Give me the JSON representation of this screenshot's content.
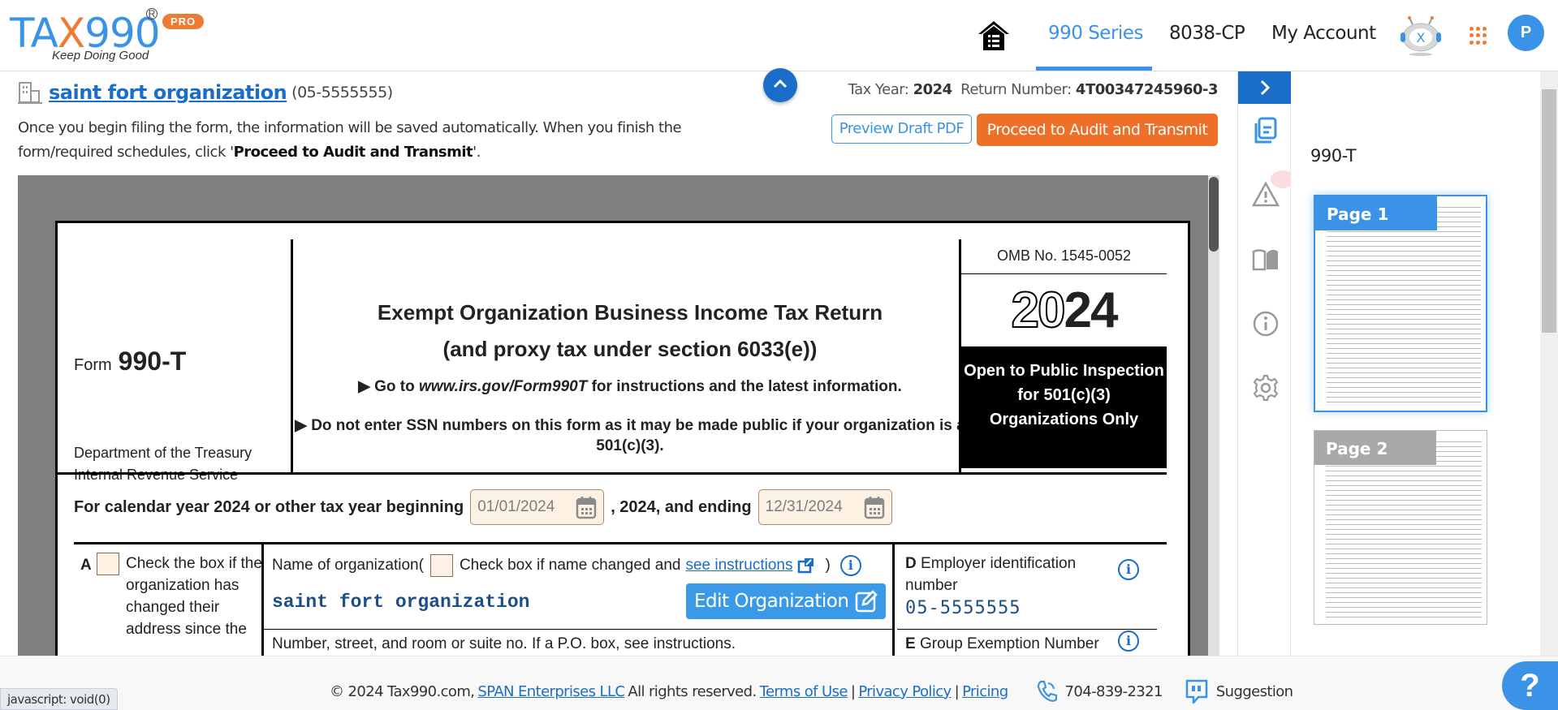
{
  "header": {
    "logo": {
      "brand_pre": "TA",
      "brand_x": "X",
      "brand_post": "990",
      "registered": "R",
      "badge": "PRO",
      "tagline": "Keep Doing Good"
    },
    "nav": [
      {
        "label": "990 Series",
        "active": true
      },
      {
        "label": "8038-CP",
        "active": false
      },
      {
        "label": "My Account",
        "active": false
      }
    ],
    "avatar_initial": "P",
    "bot_letter": "X"
  },
  "org": {
    "name": "saint fort organization",
    "ein_display": "(05-5555555)",
    "hint_pre": "Once you begin filing the form, the information will be saved automatically. When you finish the form/required schedules, click '",
    "hint_bold": "Proceed to Audit and Transmit",
    "hint_post": "'."
  },
  "return_info": {
    "tax_year_label": "Tax Year:",
    "tax_year": "2024",
    "return_number_label": "Return Number:",
    "return_number": "4T00347245960-3"
  },
  "actions": {
    "collapse": "^",
    "preview": "Preview Draft PDF",
    "proceed": "Proceed to Audit and Transmit"
  },
  "form": {
    "form_word": "Form",
    "form_number": "990-T",
    "dept1": "Department of the Treasury",
    "dept2": "Internal Revenue Service",
    "title1": "Exempt Organization Business Income Tax Return",
    "title2": "(and proxy tax under section 6033(e))",
    "go_pre": "▶ Go to ",
    "go_url": "www.irs.gov/Form990T",
    "go_post": " for instructions and the latest information.",
    "ssn_warning": "▶ Do not enter SSN numbers on this form as it may be made public if your organization is a 501(c)(3).",
    "omb": "OMB No. 1545-0052",
    "year_outline": "20",
    "year_solid": "24",
    "open_public": "Open to Public Inspection for 501(c)(3) Organizations Only",
    "cal_label": "For calendar year 2024 or other tax year beginning",
    "begin_date": "01/01/2024",
    "cal_mid": ", 2024, and ending",
    "end_date": "12/31/2024",
    "a_letter": "A",
    "a_text": "Check the box if the organization has changed their address since the",
    "name_label": "Name of organization(",
    "name_check_text": "Check box if name changed and",
    "see_instructions": "see instructions",
    "name_close": ")",
    "org_value": "saint fort organization",
    "edit_org": "Edit Organization",
    "street_label": "Number, street, and room or suite no. If a P.O. box, see instructions.",
    "d_letter": "D",
    "d_label": "Employer identification number",
    "ein_value": "05-5555555",
    "e_letter": "E",
    "e_label": "Group Exemption Number",
    "info_glyph": "i"
  },
  "sidebar": {
    "toggle": "›",
    "items": [
      "form-list",
      "alerts",
      "guide",
      "info",
      "settings"
    ]
  },
  "thumbnails": {
    "title": "990-T",
    "pages": [
      {
        "label": "Page 1",
        "active": true
      },
      {
        "label": "Page 2",
        "active": false
      }
    ]
  },
  "footer": {
    "copyright": "© 2024 Tax990.com,",
    "company": "SPAN Enterprises LLC",
    "rights": "All rights reserved.",
    "terms": "Terms of Use",
    "privacy": "Privacy Policy",
    "pricing": "Pricing",
    "sep": "|",
    "phone": "704-839-2321",
    "suggestion": "Suggestion",
    "help": "?"
  },
  "status_bar": "javascript: void(0)",
  "colors": {
    "brand_blue": "#3a93e6",
    "brand_orange": "#ee7a34",
    "link_blue": "#1a6dc9",
    "field_bg": "#fdf1e4"
  }
}
